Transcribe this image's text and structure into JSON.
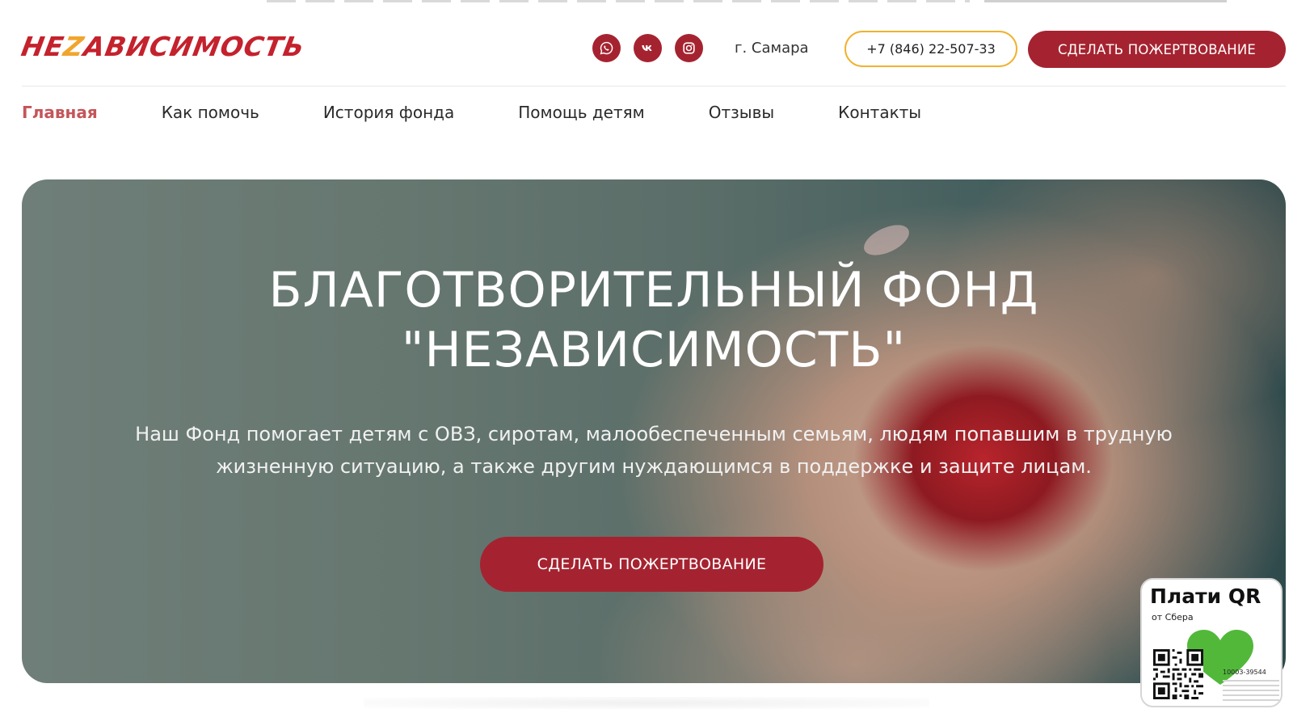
{
  "header": {
    "logo": {
      "part1": "НЕ",
      "accent": "Z",
      "part2": "АВИСИМОСТЬ",
      "brand_color": "#c4222d",
      "accent_color": "#f1a52e"
    },
    "socials": [
      {
        "icon": "whatsapp-icon"
      },
      {
        "icon": "vk-icon"
      },
      {
        "icon": "instagram-icon"
      }
    ],
    "city": "г. Самара",
    "phone": "+7 (846) 22-507-33",
    "donate_label": "СДЕЛАТЬ ПОЖЕРТВОВАНИЕ"
  },
  "nav": {
    "items": [
      {
        "label": "Главная",
        "active": true
      },
      {
        "label": "Как помочь"
      },
      {
        "label": "История фонда"
      },
      {
        "label": "Помощь детям"
      },
      {
        "label": "Отзывы"
      },
      {
        "label": "Контакты"
      }
    ]
  },
  "hero": {
    "title_line1": "БЛАГОТВОРИТЕЛЬНЫЙ ФОНД",
    "title_line2": "\"НЕЗАВИСИМОСТЬ\"",
    "subtitle_line1": "Наш Фонд помогает детям с ОВЗ, сиротам, малообеспеченным семьям, людям попавшим в трудную",
    "subtitle_line2": "жизненную ситуацию, а также другим нуждающимся в поддержке и защите лицам.",
    "cta_label": "СДЕЛАТЬ ПОЖЕРТВОВАНИЕ"
  },
  "qr_widget": {
    "title": "Плати QR",
    "subtitle": "от Сбера",
    "code_id": "10003-39544"
  },
  "colors": {
    "primary": "#a52330",
    "phone_border": "#f0b22e",
    "nav_active": "#c4555a"
  }
}
